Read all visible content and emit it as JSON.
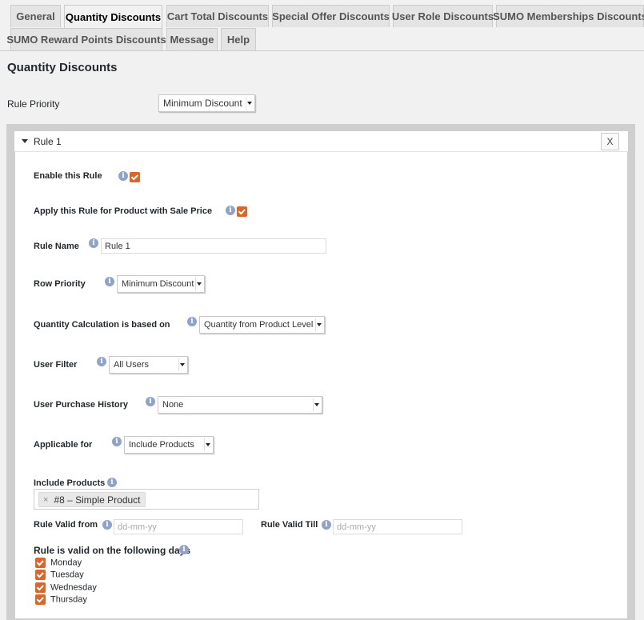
{
  "tabs": [
    {
      "label": "General"
    },
    {
      "label": "Quantity Discounts",
      "active": true
    },
    {
      "label": "Cart Total Discounts"
    },
    {
      "label": "Special Offer Discounts"
    },
    {
      "label": "User Role Discounts"
    },
    {
      "label": "SUMO Memberships Discounts"
    },
    {
      "label": "SUMO Reward Points Discounts"
    },
    {
      "label": "Message"
    },
    {
      "label": "Help"
    }
  ],
  "page": {
    "title": "Quantity Discounts",
    "rule_priority_label": "Rule Priority",
    "rule_priority_value": "Minimum Discount"
  },
  "rule": {
    "title": "Rule 1",
    "remove_label": "X",
    "enable_label": "Enable this Rule",
    "enable_checked": true,
    "sale_label": "Apply this Rule for Product with Sale Price",
    "sale_checked": true,
    "name_label": "Rule Name",
    "name_value": "Rule 1",
    "row_priority_label": "Row Priority",
    "row_priority_value": "Minimum Discount",
    "qty_calc_label": "Quantity Calculation is based on",
    "qty_calc_value": "Quantity from Product Level",
    "user_filter_label": "User Filter",
    "user_filter_value": "All Users",
    "history_label": "User Purchase History",
    "history_value": "None",
    "applicable_label": "Applicable for",
    "applicable_value": "Include Products",
    "include_label": "Include Products",
    "include_token": "#8 – Simple Product",
    "token_remove": "×",
    "valid_from_label": "Rule Valid from",
    "valid_from_placeholder": "dd-mm-yy",
    "valid_till_label": "Rule Valid Till",
    "valid_till_placeholder": "dd-mm-yy",
    "days_label": "Rule is valid on the following days",
    "days": [
      {
        "label": "Monday",
        "checked": true
      },
      {
        "label": "Tuesday",
        "checked": true
      },
      {
        "label": "Wednesday",
        "checked": true
      },
      {
        "label": "Thursday",
        "checked": true
      }
    ]
  },
  "icons": {
    "info": "info-icon",
    "checkbox": "checkmark",
    "dropdown": "caret-down-icon"
  },
  "colors": {
    "accent_checkbox": "#d9672d",
    "info_icon": "#8fa3c9",
    "background": "#f1f1f1"
  }
}
